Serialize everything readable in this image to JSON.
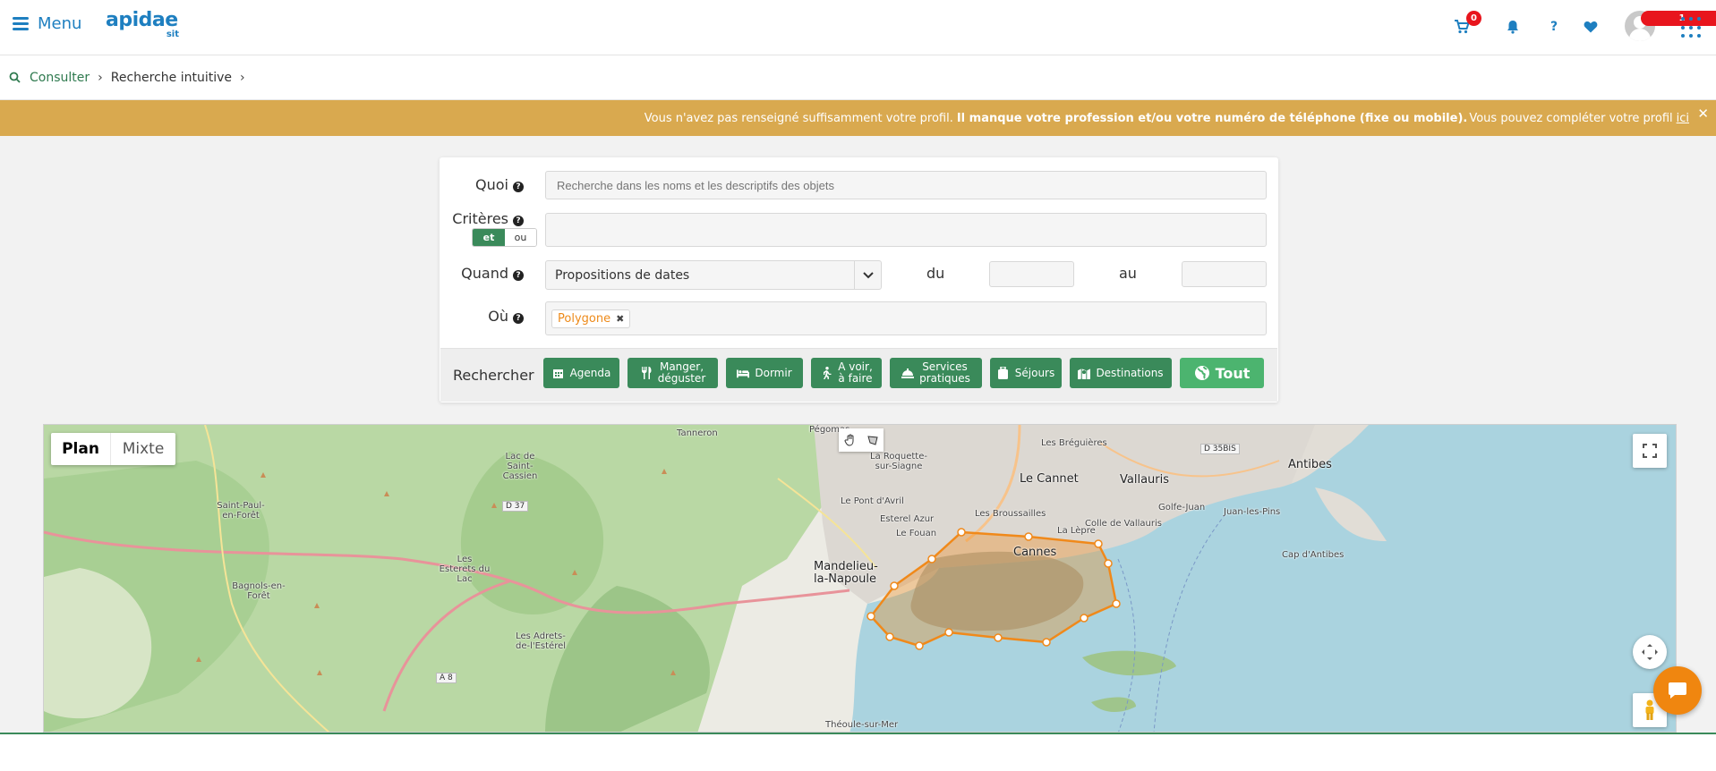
{
  "topbar": {
    "menu_label": "Menu",
    "logo_text": "apidae",
    "logo_sub": "sit",
    "cart_count": "0",
    "help_label": "?",
    "notif_count": "1"
  },
  "breadcrumb": {
    "items": [
      "Consulter",
      "Recherche intuitive"
    ]
  },
  "alert": {
    "text_plain": "Vous n'avez pas renseigné suffisamment votre profil.",
    "text_bold": "Il manque votre profession et/ou votre numéro de téléphone (fixe ou mobile).",
    "text_after": "Vous pouvez compléter votre profil",
    "link": "ici",
    "close": "✕"
  },
  "search": {
    "quoi_label": "Quoi",
    "quoi_placeholder": "Recherche dans les noms et les descriptifs des objets",
    "criteres_label": "Critères",
    "toggle_and": "et",
    "toggle_or": "ou",
    "quand_label": "Quand",
    "quand_value": "Propositions de dates",
    "du_label": "du",
    "au_label": "au",
    "ou_label": "Où",
    "ou_chip": "Polygone",
    "help_icon": "?"
  },
  "actions": {
    "label": "Rechercher",
    "buttons": [
      {
        "label": "Agenda"
      },
      {
        "label": "Manger,\ndéguster"
      },
      {
        "label": "Dormir"
      },
      {
        "label": "A voir,\nà faire"
      },
      {
        "label": "Services\npratiques"
      },
      {
        "label": "Séjours"
      },
      {
        "label": "Destinations"
      },
      {
        "label": "Tout"
      }
    ]
  },
  "map": {
    "modes": [
      "Plan",
      "Mixte"
    ],
    "places": [
      "Pégomas",
      "Tanneron",
      "La Roquette-sur-Siagne",
      "Le Cannet",
      "Les Bréguières",
      "Vallauris",
      "Antibes",
      "Saint-Paul-en-Forêt",
      "Lac de Saint-Cassien",
      "Le Pont d'Avril",
      "Les Broussailles",
      "Colle de Vallauris",
      "Golfe-Juan",
      "Juan-les-Pins",
      "Esterel Azur",
      "Le Fouan",
      "La Lèpre",
      "Cap d'Antibes",
      "Les Esterets du Lac",
      "Cannes",
      "Bagnols-en-Forêt",
      "Mandelieu-la-Napoule",
      "Les Adrets-de-l'Estérel",
      "Théoule-sur-Mer"
    ],
    "roads": [
      "D 37",
      "A 8",
      "D 35BIS"
    ],
    "colors": {
      "polygon": "#f0891a",
      "water": "#aad3df",
      "land": "#f1efe9",
      "forest": "#b8d6a3"
    }
  }
}
